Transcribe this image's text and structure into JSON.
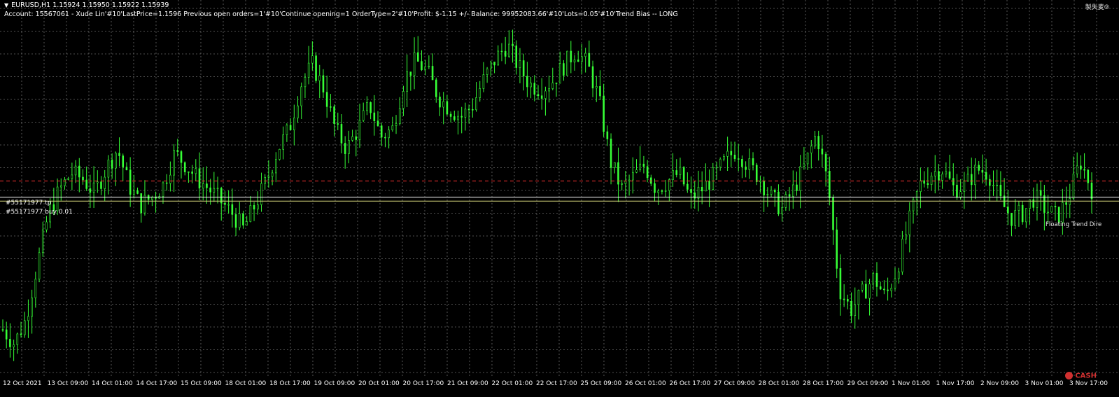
{
  "header": {
    "symbol_line": "EURUSD,H1  1.15924 1.15950 1.15922 1.15939",
    "comment_line": "Account: 15567061 - Xude Lin'#10'LastPrice=1.1596 Previous open orders=1'#10'Continue opening=1 OrderType=2'#10'Profit: $-1.15 +/-  Balance: 99952083.66'#10'Lots=0.05'#10'Trend Bias -- LONG"
  },
  "corner_text": "製失麦⦾",
  "orders": {
    "tp_label": "#55171977 tp",
    "buy_label": "#55171977 buy 0.01"
  },
  "trend_label": "Floating Trend Dire",
  "time_axis": {
    "labels": [
      "12 Oct 2021",
      "13 Oct 09:00",
      "14 Oct 01:00",
      "14 Oct 17:00",
      "15 Oct 09:00",
      "18 Oct 01:00",
      "18 Oct 17:00",
      "19 Oct 09:00",
      "20 Oct 01:00",
      "20 Oct 17:00",
      "21 Oct 09:00",
      "22 Oct 01:00",
      "22 Oct 17:00",
      "25 Oct 09:00",
      "26 Oct 01:00",
      "26 Oct 17:00",
      "27 Oct 09:00",
      "28 Oct 01:00",
      "28 Oct 17:00",
      "29 Oct 09:00",
      "1 Nov 01:00",
      "1 Nov 17:00",
      "2 Nov 09:00",
      "3 Nov 01:00",
      "3 Nov 17:00"
    ]
  },
  "watermark": "CASH",
  "colors": {
    "background": "#000000",
    "grid": "#6b6b6b",
    "candles": "#36ff36",
    "tp_line": "#ff3333",
    "order_line": "#ffffff",
    "trend_line": "#d6d67a"
  },
  "chart_data": {
    "type": "line",
    "title": "EURUSD,H1",
    "series": [
      {
        "values": [
          1.154,
          1.1533,
          1.1545,
          1.1572,
          1.1598,
          1.161,
          1.1618,
          1.1615,
          1.1608,
          1.162,
          1.163,
          1.1612,
          1.1602,
          1.1606,
          1.1612,
          1.1628,
          1.1622,
          1.1615,
          1.161,
          1.1604,
          1.1598,
          1.159,
          1.1602,
          1.1614,
          1.163,
          1.164,
          1.1662,
          1.1672,
          1.166,
          1.164,
          1.163,
          1.164,
          1.1652,
          1.1636,
          1.164,
          1.1664,
          1.1674,
          1.1669,
          1.1656,
          1.165,
          1.1646,
          1.1652,
          1.1665,
          1.1675,
          1.1682,
          1.1671,
          1.1662,
          1.166,
          1.1664,
          1.1672,
          1.1679,
          1.1672,
          1.1655,
          1.1624,
          1.161,
          1.1616,
          1.1622,
          1.161,
          1.1614,
          1.1618,
          1.1605,
          1.161,
          1.1616,
          1.1624,
          1.163,
          1.1622,
          1.1616,
          1.1606,
          1.16,
          1.161,
          1.1622,
          1.1638,
          1.1612,
          1.156,
          1.155,
          1.1558,
          1.1566,
          1.1556,
          1.157,
          1.1592,
          1.1612,
          1.1618,
          1.162,
          1.161,
          1.1612,
          1.162,
          1.1618,
          1.1604,
          1.1596,
          1.1598,
          1.1606,
          1.16,
          1.1596,
          1.1606,
          1.1624,
          1.161
        ],
        "low_wicks": "estimated from shape"
      }
    ],
    "ylim": [
      1.152,
      1.17
    ],
    "xlabel": "",
    "ylabel": "",
    "grid": true,
    "levels": {
      "take_profit": 1.1614,
      "buy_open": 1.1606,
      "floating_trend": 1.1604
    }
  }
}
